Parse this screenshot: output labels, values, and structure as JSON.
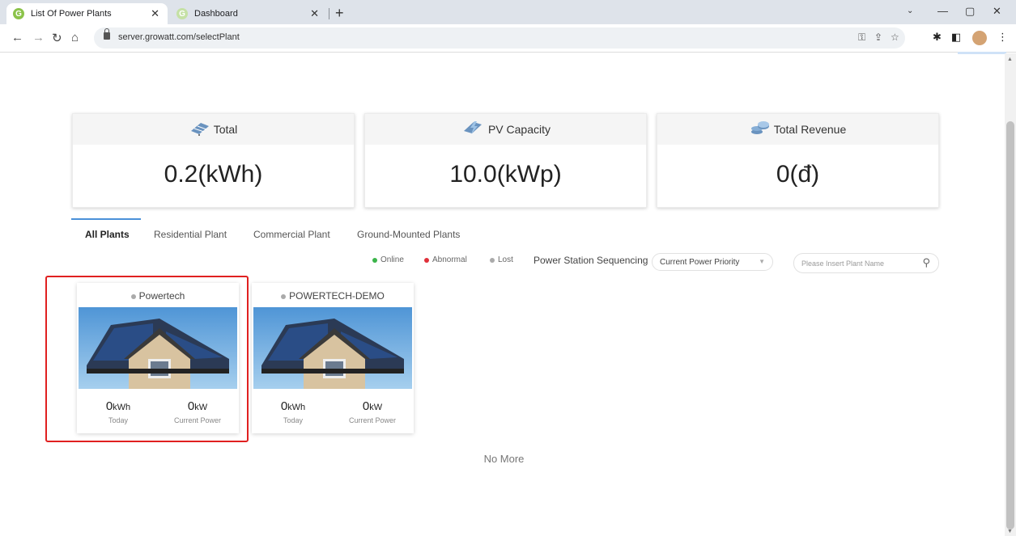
{
  "browser": {
    "tabs": [
      {
        "title": "List Of Power Plants",
        "active": true
      },
      {
        "title": "Dashboard",
        "active": false
      }
    ],
    "url": "server.growatt.com/selectPlant"
  },
  "summary": {
    "total": {
      "label": "Total",
      "value": "0.2(kWh)",
      "icon": "solar-panel-icon"
    },
    "pv": {
      "label": "PV Capacity",
      "value": "10.0(kWp)",
      "icon": "lightning-icon"
    },
    "revenue": {
      "label": "Total Revenue",
      "value": "0(đ)",
      "icon": "coins-icon"
    }
  },
  "plant_tabs": [
    "All Plants",
    "Residential Plant",
    "Commercial Plant",
    "Ground-Mounted Plants"
  ],
  "legend": [
    {
      "label": "Online",
      "color": "#3bb44a"
    },
    {
      "label": "Abnormal",
      "color": "#e0303a"
    },
    {
      "label": "Lost",
      "color": "#aaaaaa"
    }
  ],
  "sequencing": {
    "label": "Power Station Sequencing",
    "selected": "Current Power Priority"
  },
  "search": {
    "placeholder": "Please Insert Plant Name"
  },
  "plants": [
    {
      "name": "Powertech",
      "today_num": "0",
      "today_unit": "kWh",
      "today_label": "Today",
      "power_num": "0",
      "power_unit": "kW",
      "power_label": "Current Power"
    },
    {
      "name": "POWERTECH-DEMO",
      "today_num": "0",
      "today_unit": "kWh",
      "today_label": "Today",
      "power_num": "0",
      "power_unit": "kW",
      "power_label": "Current Power"
    }
  ],
  "footer": {
    "no_more": "No More"
  }
}
